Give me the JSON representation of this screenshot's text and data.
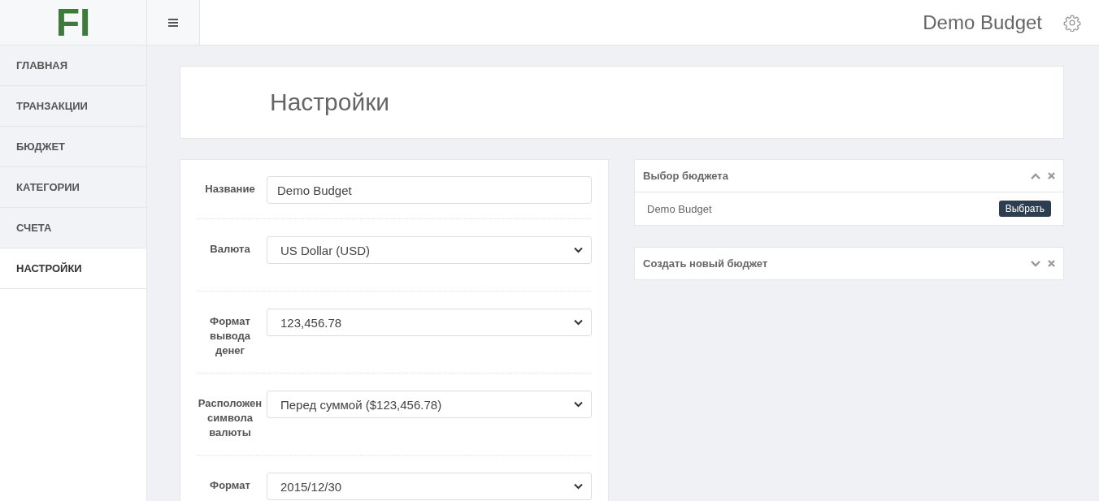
{
  "logo": "FI",
  "header": {
    "budget_name": "Demo Budget"
  },
  "sidebar": {
    "items": [
      {
        "label": "ГЛАВНАЯ",
        "selected": false
      },
      {
        "label": "ТРАНЗАКЦИИ",
        "selected": false
      },
      {
        "label": "БЮДЖЕТ",
        "selected": false
      },
      {
        "label": "КАТЕГОРИИ",
        "selected": false
      },
      {
        "label": "СЧЕТА",
        "selected": false
      },
      {
        "label": "НАСТРОЙКИ",
        "selected": true
      }
    ]
  },
  "page_title": "Настройки",
  "form": {
    "fields": [
      {
        "label": "Название",
        "value": "Demo Budget",
        "kind": "text"
      },
      {
        "label": "Валюта",
        "value": "US Dollar (USD)",
        "kind": "select"
      },
      {
        "label": "Формат вывода денег",
        "value": "123,456.78",
        "kind": "select"
      },
      {
        "label": "Расположен символа валюты",
        "value": "Перед суммой ($123,456.78)",
        "kind": "select"
      },
      {
        "label": "Формат",
        "value": "2015/12/30",
        "kind": "select"
      }
    ]
  },
  "panels": [
    {
      "title": "Выбор бюджета",
      "expanded": true,
      "items": [
        {
          "name": "Demo Budget",
          "button": "Выбрать"
        }
      ]
    },
    {
      "title": "Создать новый бюджет",
      "expanded": false
    }
  ]
}
